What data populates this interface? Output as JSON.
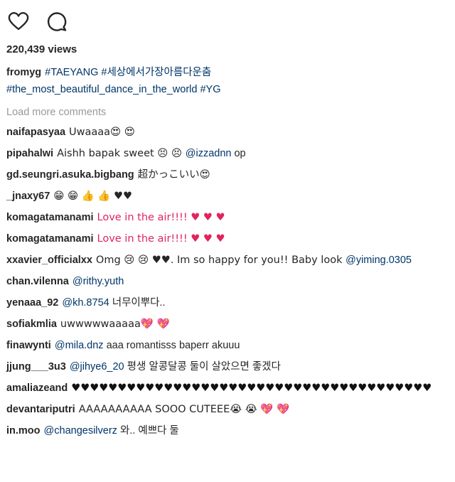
{
  "views": "220,439 views",
  "caption": {
    "user": "fromyg",
    "tag1": "#TAEYANG",
    "tag2": "#세상에서가장아름다운춤",
    "tag3": "#the_most_beautiful_dance_in_the_world",
    "tag4": "#YG"
  },
  "load_more": "Load more comments",
  "comments": [
    {
      "user": "naifapasyaa",
      "text": "Uwaaaa😍 😍"
    },
    {
      "user": "pipahalwi",
      "text": "Aishh bapak sweet 😣 😣 ",
      "mention": "@izzadnn",
      "after": " op"
    },
    {
      "user": "gd.seungri.asuka.bigbang",
      "text": "超かっこいい😍"
    },
    {
      "user": "_jnaxy67",
      "text": "😁 😁 👍 👍 ♥♥"
    },
    {
      "user": "komagatamanami",
      "text": "Love in the air!!!! ♥ ♥ ♥"
    },
    {
      "user": "komagatamanami",
      "text": "Love in the air!!!! ♥ ♥ ♥"
    },
    {
      "user": "xxavier_officialxx",
      "text": "Omg 😢 😢 ♥♥. Im so happy for you!! Baby look ",
      "mention": "@yiming.0305"
    },
    {
      "user": "chan.vilenna",
      "mention": "@rithy.yuth"
    },
    {
      "user": "yenaaa_92",
      "mention": "@kh.8754",
      "after": " 너무이뿌다.."
    },
    {
      "user": "sofiakmlia",
      "text": "uwwwwwaaaaa💖 💖"
    },
    {
      "user": "finawynti",
      "mention": "@mila.dnz",
      "after": " aaa romantisss baperr akuuu"
    },
    {
      "user": "jjung___3u3",
      "mention": "@jihye6_20",
      "after": " 평생 알콩달콩 둘이 살았으면 좋겠다"
    },
    {
      "user": "amaliazeand",
      "text": "♥♥♥♥♥♥♥♥♥♥♥♥♥♥♥♥♥♥♥♥♥♥♥♥♥♥♥♥♥♥♥♥♥♥♥♥♥♥♥"
    },
    {
      "user": "devantariputri",
      "text": "AAAAAAAAAA SOOO CUTEEE😭 😭 💖 💖"
    },
    {
      "user": "in.moo",
      "mention": "@changesilverz",
      "after": " 와.. 예쁘다 둘"
    }
  ]
}
